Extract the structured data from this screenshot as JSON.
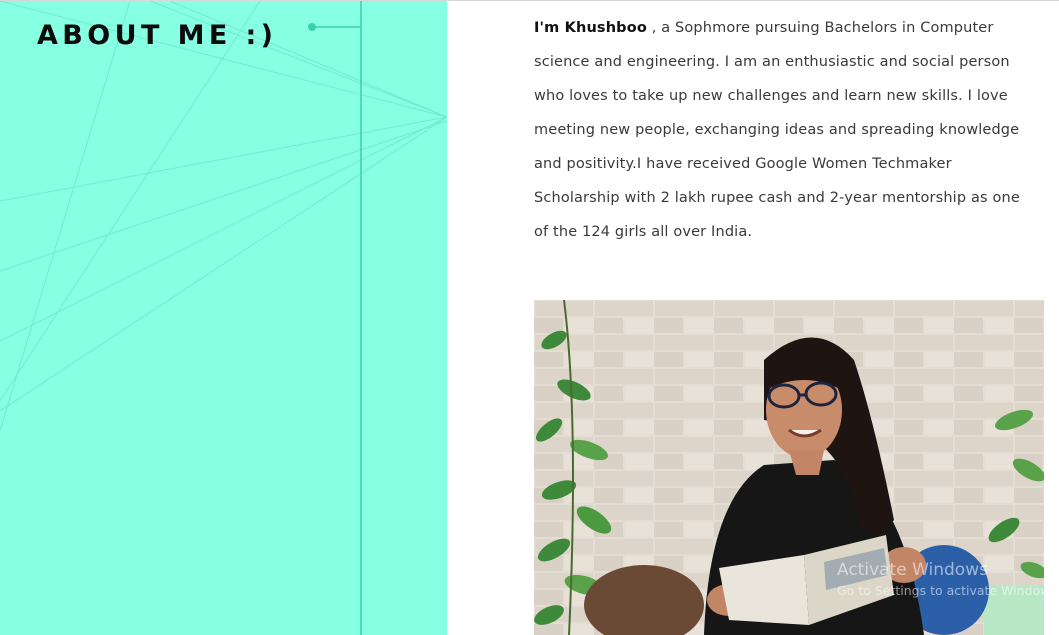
{
  "about": {
    "title": "ABOUT ME :)",
    "bio_name": "I'm Khushboo",
    "bio_text": " , a Sophmore pursuing Bachelors in Computer science and engineering. I am an enthusiastic and social person who loves to take up new challenges and learn new skills. I love meeting new people, exchanging ideas and spreading knowledge and positivity.I have received Google Women Techmaker Scholarship with 2 lakh rupee cash and 2-year mentorship as one of the 124 girls all over India."
  },
  "theme": {
    "panel_color": "#86ffe3",
    "line_color": "#3ccfaa",
    "text_color": "#3a3a3a"
  },
  "windows_watermark": {
    "line1": "Activate Windows",
    "line2": "Go to Settings to activate Windows."
  }
}
